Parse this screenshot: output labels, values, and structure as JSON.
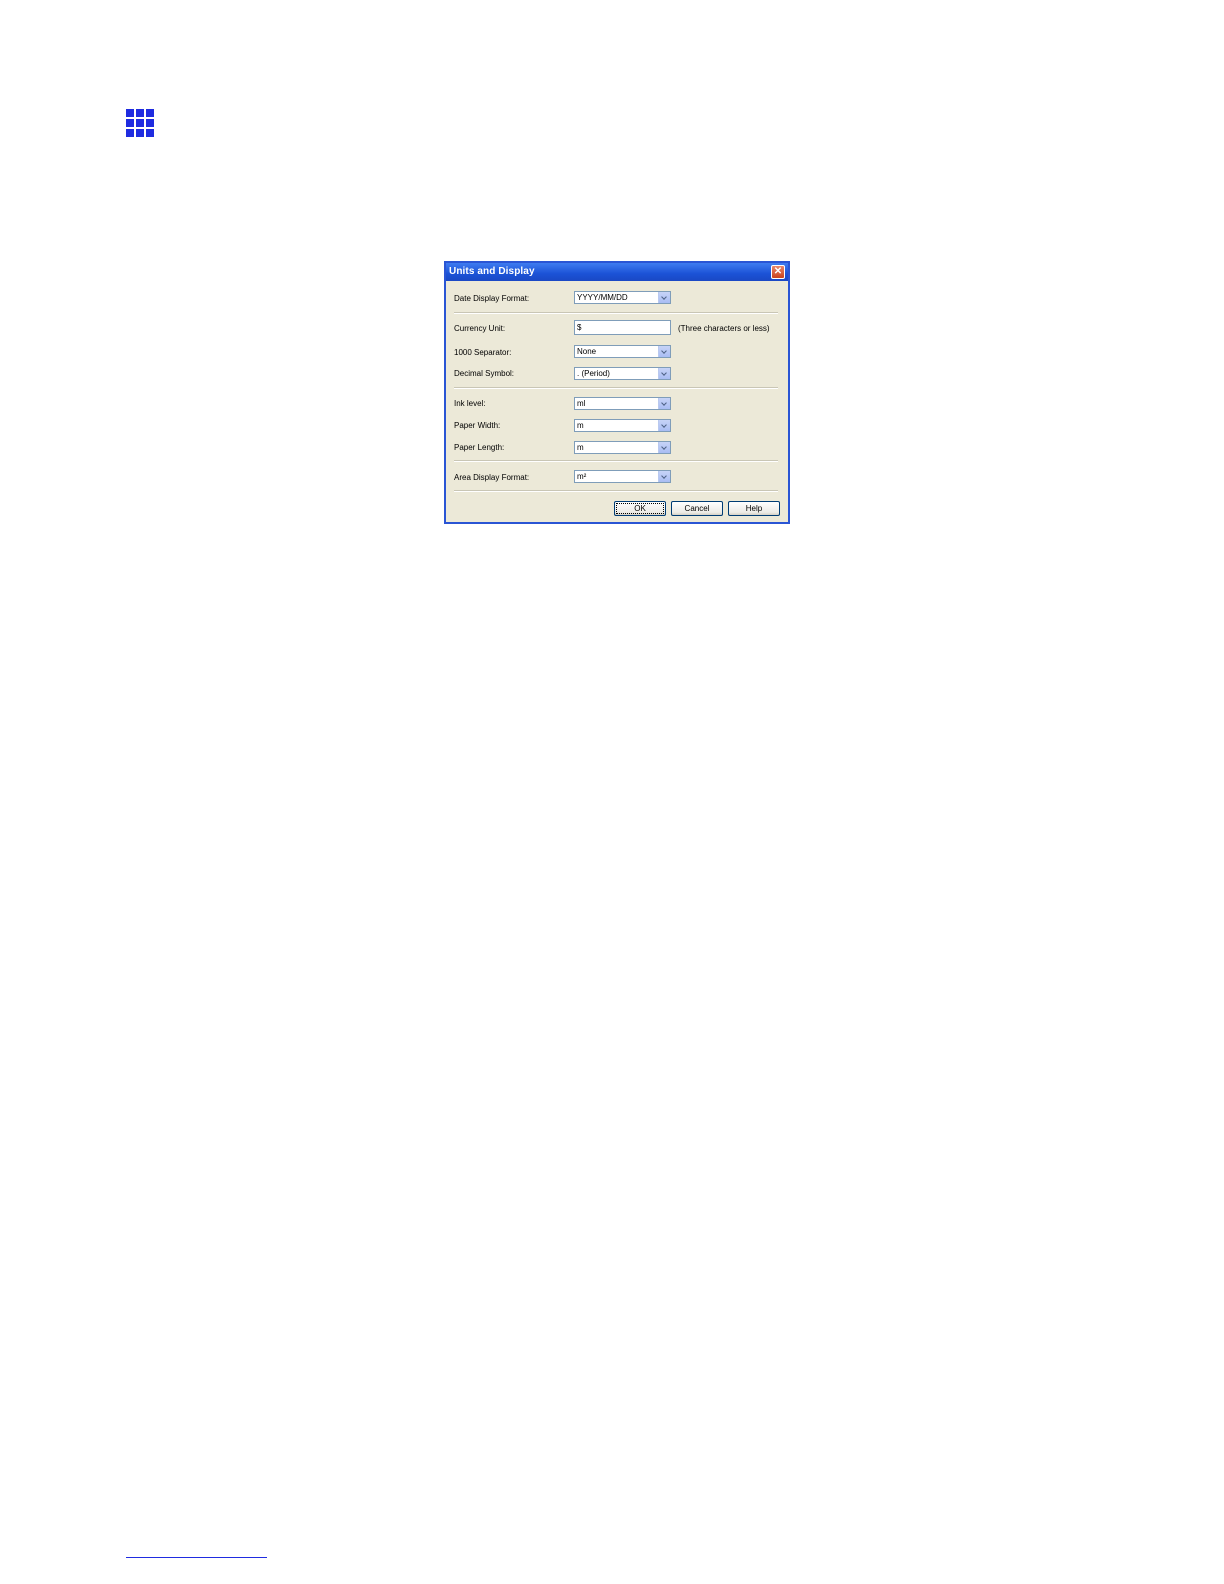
{
  "dialog": {
    "title": "Units and Display",
    "close_glyph": "✕",
    "fields": {
      "date_display_format": {
        "label": "Date Display Format:",
        "value": "YYYY/MM/DD"
      },
      "currency_unit": {
        "label": "Currency Unit:",
        "value": "$",
        "hint": "(Three characters or less)"
      },
      "thousand_separator": {
        "label": "1000 Separator:",
        "value": "None"
      },
      "decimal_symbol": {
        "label": "Decimal Symbol:",
        "value": ". (Period)"
      },
      "ink_level": {
        "label": "Ink level:",
        "value": "ml"
      },
      "paper_width": {
        "label": "Paper Width:",
        "value": "m"
      },
      "paper_length": {
        "label": "Paper Length:",
        "value": "m"
      },
      "area_display_format": {
        "label": "Area Display Format:",
        "value": "m²"
      }
    },
    "buttons": {
      "ok": "OK",
      "cancel": "Cancel",
      "help": "Help"
    }
  },
  "colors": {
    "accent": "#1f2ce0",
    "titlebar": "#1b52d6",
    "dialog_bg": "#ece9d8"
  },
  "icons": {
    "section_marker": "grid-icon"
  }
}
